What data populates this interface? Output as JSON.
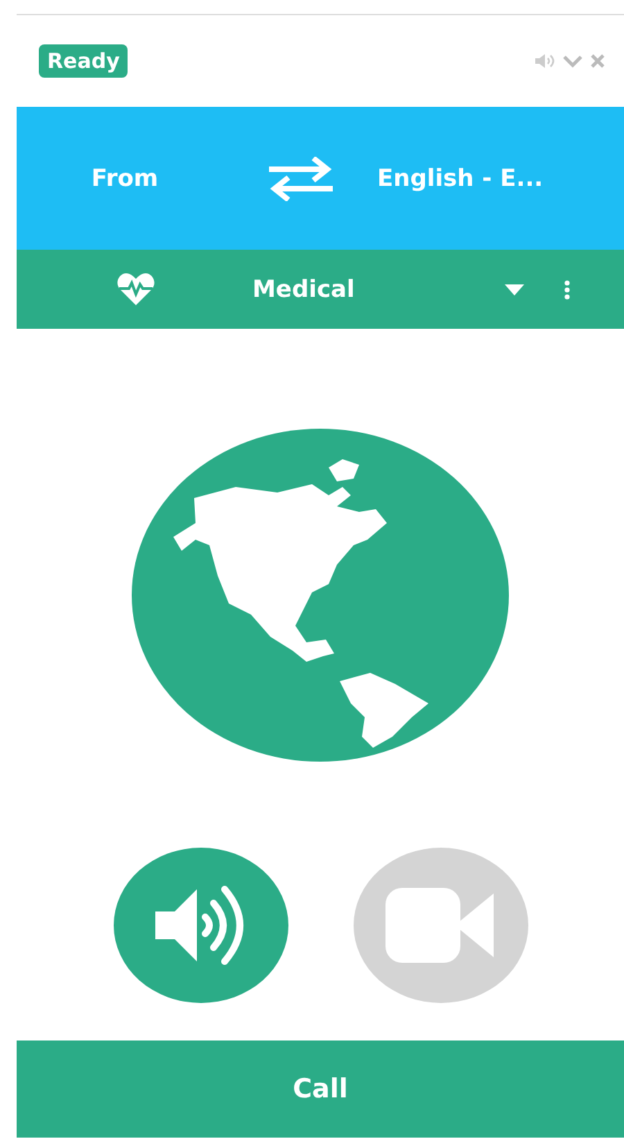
{
  "status": {
    "label": "Ready"
  },
  "language_bar": {
    "from_label": "From",
    "language": "English - E..."
  },
  "domain_bar": {
    "domain": "Medical"
  },
  "modes": [
    {
      "kind": "audio",
      "selected": true
    },
    {
      "kind": "video",
      "selected": false
    }
  ],
  "call_button": {
    "label": "Call"
  }
}
